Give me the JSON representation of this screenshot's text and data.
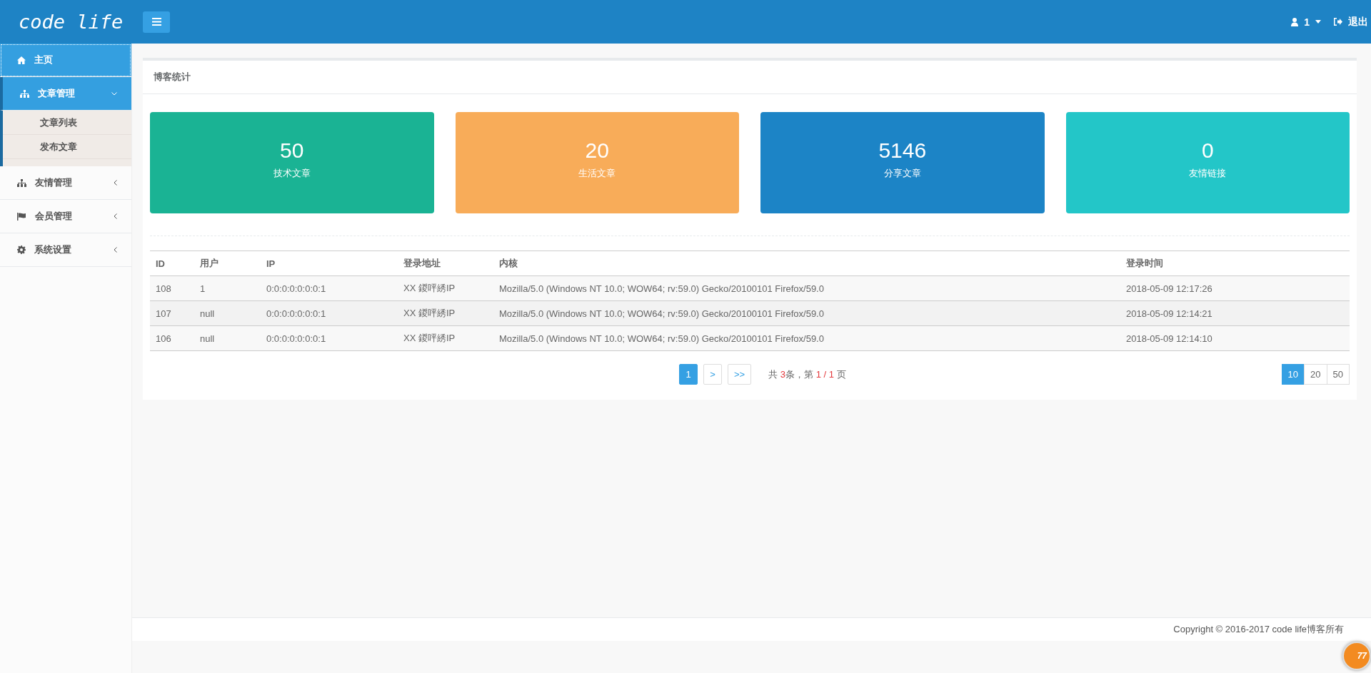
{
  "header": {
    "logo": "code life",
    "user": "1",
    "logout": "退出"
  },
  "sidebar": {
    "items": [
      {
        "label": "主页",
        "selected": true
      },
      {
        "label": "文章管理",
        "selected": false,
        "expanded": true,
        "children": [
          {
            "label": "文章列表"
          },
          {
            "label": "发布文章"
          }
        ]
      },
      {
        "label": "友情管理",
        "selected": false,
        "expanded": false
      },
      {
        "label": "会员管理",
        "selected": false,
        "expanded": false
      },
      {
        "label": "系统设置",
        "selected": false,
        "expanded": false
      }
    ]
  },
  "panel": {
    "title": "博客统计",
    "stats": [
      {
        "value": "50",
        "label": "技术文章",
        "color": "#1ab394"
      },
      {
        "value": "20",
        "label": "生活文章",
        "color": "#f8ac59"
      },
      {
        "value": "5146",
        "label": "分享文章",
        "color": "#1c84c6"
      },
      {
        "value": "0",
        "label": "友情链接",
        "color": "#23c6c8"
      }
    ],
    "table": {
      "columns": [
        "ID",
        "用户",
        "IP",
        "登录地址",
        "内核",
        "登录时间"
      ],
      "rows": [
        [
          "108",
          "1",
          "0:0:0:0:0:0:0:1",
          "XX 鍐呯綉IP",
          "Mozilla/5.0 (Windows NT 10.0; WOW64; rv:59.0) Gecko/20100101 Firefox/59.0",
          "2018-05-09 12:17:26"
        ],
        [
          "107",
          "null",
          "0:0:0:0:0:0:0:1",
          "XX 鍐呯綉IP",
          "Mozilla/5.0 (Windows NT 10.0; WOW64; rv:59.0) Gecko/20100101 Firefox/59.0",
          "2018-05-09 12:14:21"
        ],
        [
          "106",
          "null",
          "0:0:0:0:0:0:0:1",
          "XX 鍐呯綉IP",
          "Mozilla/5.0 (Windows NT 10.0; WOW64; rv:59.0) Gecko/20100101 Firefox/59.0",
          "2018-05-09 12:14:10"
        ]
      ]
    },
    "pagination": {
      "pages": [
        {
          "label": "1",
          "selected": true
        },
        {
          "label": ">",
          "selected": false
        },
        {
          "label": ">>",
          "selected": false
        }
      ],
      "summary": [
        {
          "text": "共 ",
          "kind": "plain"
        },
        {
          "text": "3",
          "kind": "number"
        },
        {
          "text": "条，第 ",
          "kind": "plain"
        },
        {
          "text": "1 / 1",
          "kind": "number"
        },
        {
          "text": " 页",
          "kind": "plain"
        }
      ],
      "page_sizes": [
        {
          "label": "10",
          "selected": true
        },
        {
          "label": "20",
          "selected": false
        },
        {
          "label": "50",
          "selected": false
        }
      ]
    }
  },
  "footer": {
    "copyright": "Copyright © 2016-2017 code life博客所有"
  },
  "badge": {
    "count": "77"
  }
}
